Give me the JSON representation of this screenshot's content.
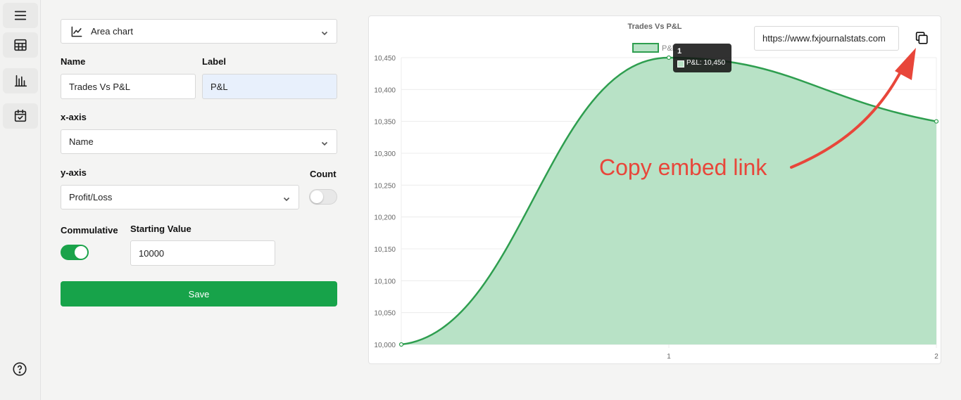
{
  "rail": {
    "items": [
      {
        "icon": "menu-icon"
      },
      {
        "icon": "table-icon"
      },
      {
        "icon": "bar-chart-icon"
      },
      {
        "icon": "calendar-check-icon"
      }
    ],
    "help_icon": "help-circle-icon"
  },
  "form": {
    "chart_type": {
      "value": "Area chart",
      "icon": "area-chart-icon"
    },
    "name": {
      "label": "Name",
      "value": "Trades Vs P&L"
    },
    "label_field": {
      "label": "Label",
      "value": "P&L"
    },
    "x_axis": {
      "label": "x-axis",
      "value": "Name"
    },
    "y_axis": {
      "label": "y-axis",
      "value": "Profit/Loss"
    },
    "count": {
      "label": "Count",
      "on": false
    },
    "cumulative": {
      "label": "Commulative",
      "on": true
    },
    "starting_value": {
      "label": "Starting Value",
      "value": "10000"
    },
    "save_label": "Save"
  },
  "embed": {
    "url": "https://www.fxjournalstats.com",
    "copy_icon": "copy-icon"
  },
  "annotation": {
    "text": "Copy embed link",
    "color": "#e8463a"
  },
  "tooltip": {
    "title": "1",
    "body": "P&L: 10,450"
  },
  "colors": {
    "accent": "#17a34a",
    "line": "#2e9e4f",
    "fill": "#b8e2c6"
  },
  "chart_data": {
    "type": "area",
    "title": "Trades Vs P&L",
    "legend": [
      "P&L"
    ],
    "legend_placement": "top",
    "x": [
      "",
      "1",
      "2"
    ],
    "series": [
      {
        "name": "P&L",
        "values": [
          10000,
          10450,
          10350
        ]
      }
    ],
    "ylim": [
      10000,
      10450
    ],
    "yticks": [
      "10,000",
      "10,050",
      "10,100",
      "10,150",
      "10,200",
      "10,250",
      "10,300",
      "10,350",
      "10,400",
      "10,450"
    ],
    "grid": true
  }
}
